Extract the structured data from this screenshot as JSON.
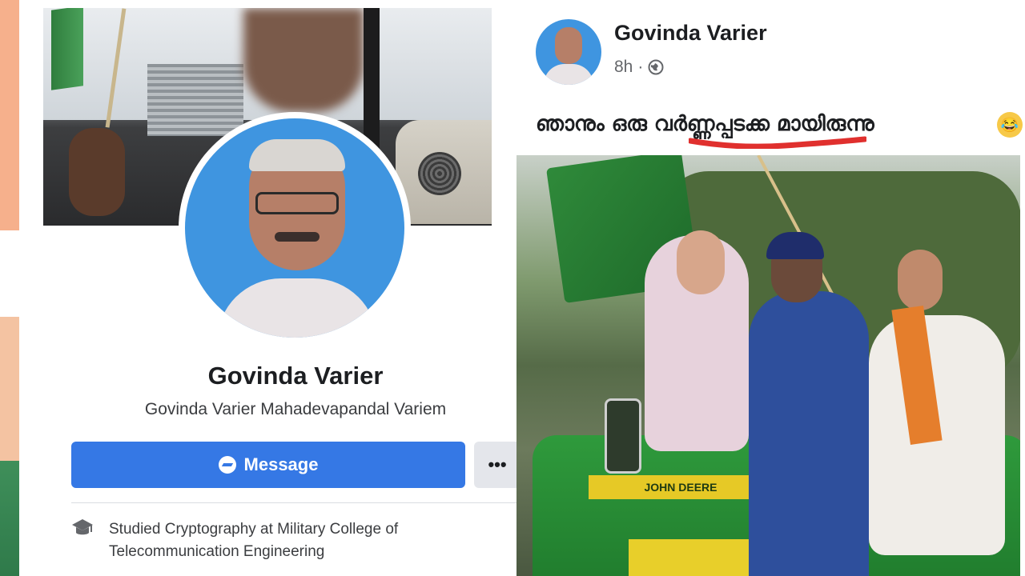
{
  "profile": {
    "name": "Govinda Varier",
    "full_name": "Govinda Varier Mahadevapandal Variem",
    "message_label": "Message",
    "more_label": "•••",
    "education_text": "Studied Cryptography at Military College of Telecommunication Engineering"
  },
  "post": {
    "author": "Govinda Varier",
    "time": "8h",
    "separator": "·",
    "caption": "ഞാനും ഒരു വർണ്ണപ്പടക്ക മായിരുന്നു",
    "emoji": "😂",
    "tractor_text": "JOHN DEERE"
  },
  "colors": {
    "accent": "#3578e5",
    "underline": "#e0302e"
  },
  "icons": {
    "messenger": "messenger-icon",
    "more": "more-icon",
    "education": "graduation-cap-icon",
    "privacy": "globe-icon"
  }
}
